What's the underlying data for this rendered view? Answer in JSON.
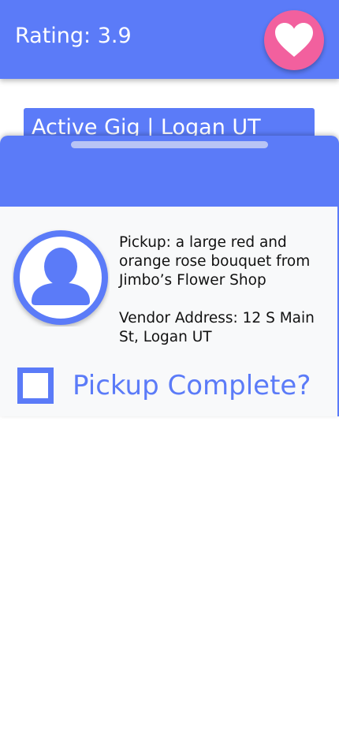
{
  "header": {
    "rating_text": "Rating: 3.9",
    "favorite_icon": "heart-icon",
    "accent_color": "#5B7BF8",
    "favorite_color": "#F2609E"
  },
  "gig": {
    "title": "Active Gig | Logan UT"
  },
  "sheet": {
    "pickup_text": "Pickup: a large red and orange rose bouquet from Jimbo’s Flower Shop",
    "vendor_text": "Vendor Address: 12 S Main St, Logan UT",
    "avatar_icon": "user-avatar-icon",
    "checkbox_label": "Pickup Complete?",
    "checkbox_checked": false
  }
}
